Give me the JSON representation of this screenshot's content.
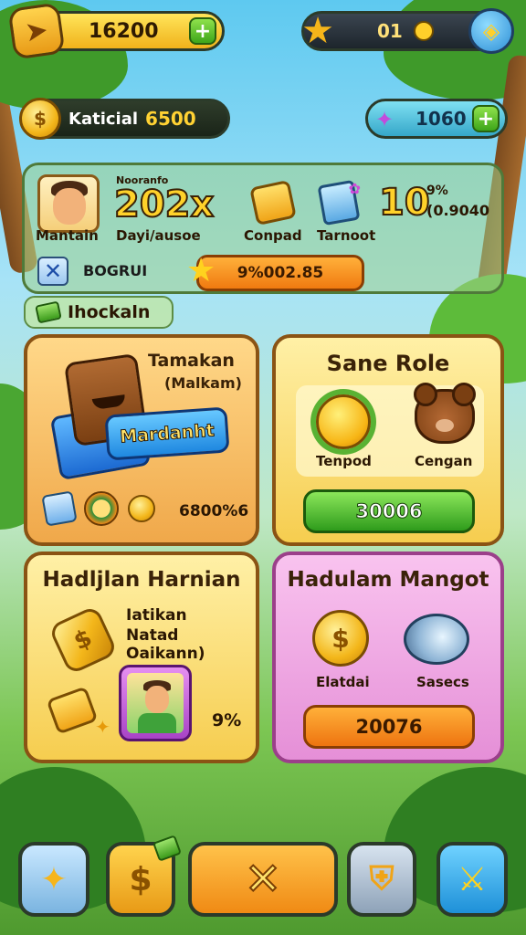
{
  "top_bar": {
    "coins": "16200",
    "level": "01"
  },
  "currencies": {
    "gold_label": "Katicial",
    "gold_value": "6500",
    "gems_value": "1060"
  },
  "stats": {
    "avatar_name": "Mantain",
    "small_label": "Nooranfo",
    "big_value": "202x",
    "sub_label": "Dayi/ausoe",
    "items": [
      {
        "label": "Conpad"
      },
      {
        "label": "Tarnoot"
      }
    ],
    "ten_value": "10",
    "pct_label": "9%",
    "pct_value": "(0.9040",
    "bonus_label": "BOGRUI",
    "bar_value": "9%002.85"
  },
  "section_tag": "Ihockaln",
  "cards": {
    "c1": {
      "title": "Tamakan",
      "subtitle": "(Malkam)",
      "button": "Mardanht",
      "value": "6800%6"
    },
    "c2": {
      "title": "Sane Role",
      "label_left": "Tenpod",
      "label_right": "Cengan",
      "button": "30006"
    },
    "c3": {
      "title": "Hadljlan Harnian",
      "sub1": "Iatikan",
      "sub2": "Natad Oaikann)",
      "pct": "9%"
    },
    "c4": {
      "title": "Hadulam Mangot",
      "label_left": "Elatdai",
      "label_right": "Sasecs",
      "button": "20076"
    }
  },
  "nav": [
    {
      "icon": "tools-icon"
    },
    {
      "icon": "coin-shop-icon"
    },
    {
      "icon": "close-icon"
    },
    {
      "icon": "shield-icon"
    },
    {
      "icon": "sword-icon"
    }
  ]
}
